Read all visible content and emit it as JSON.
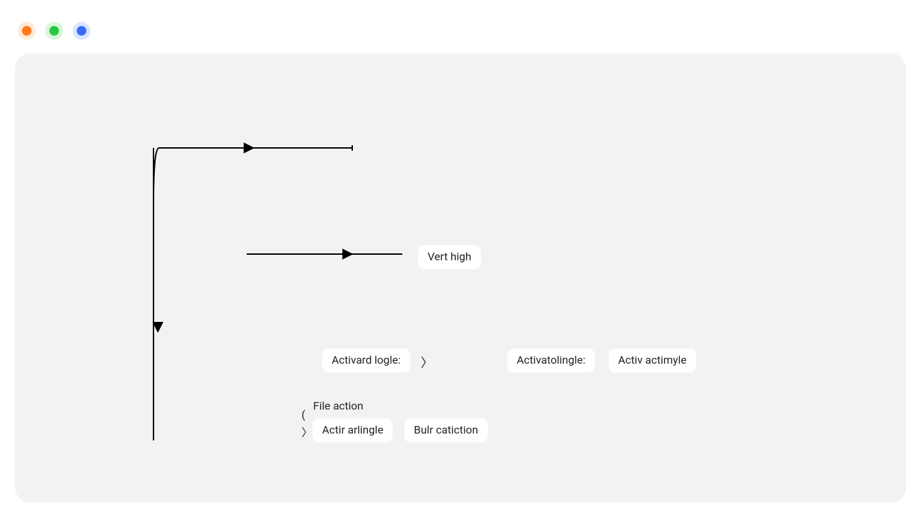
{
  "window": {
    "traffic": {
      "o": true,
      "g": true,
      "b": true
    }
  },
  "nodes": {
    "vert_high": "Vert high",
    "activard_logle": "Activard logle:",
    "activatolingle": "Activatolingle:",
    "activ_actimyle": "Activ actimyle",
    "actir_arlingle": "Actir arlingle",
    "bulr_catiction": "Bulr catiction"
  },
  "labels": {
    "file_action": "File action"
  },
  "symbols": {
    "lparen": "(",
    "rangle": "〉",
    "chevron": "〉"
  }
}
